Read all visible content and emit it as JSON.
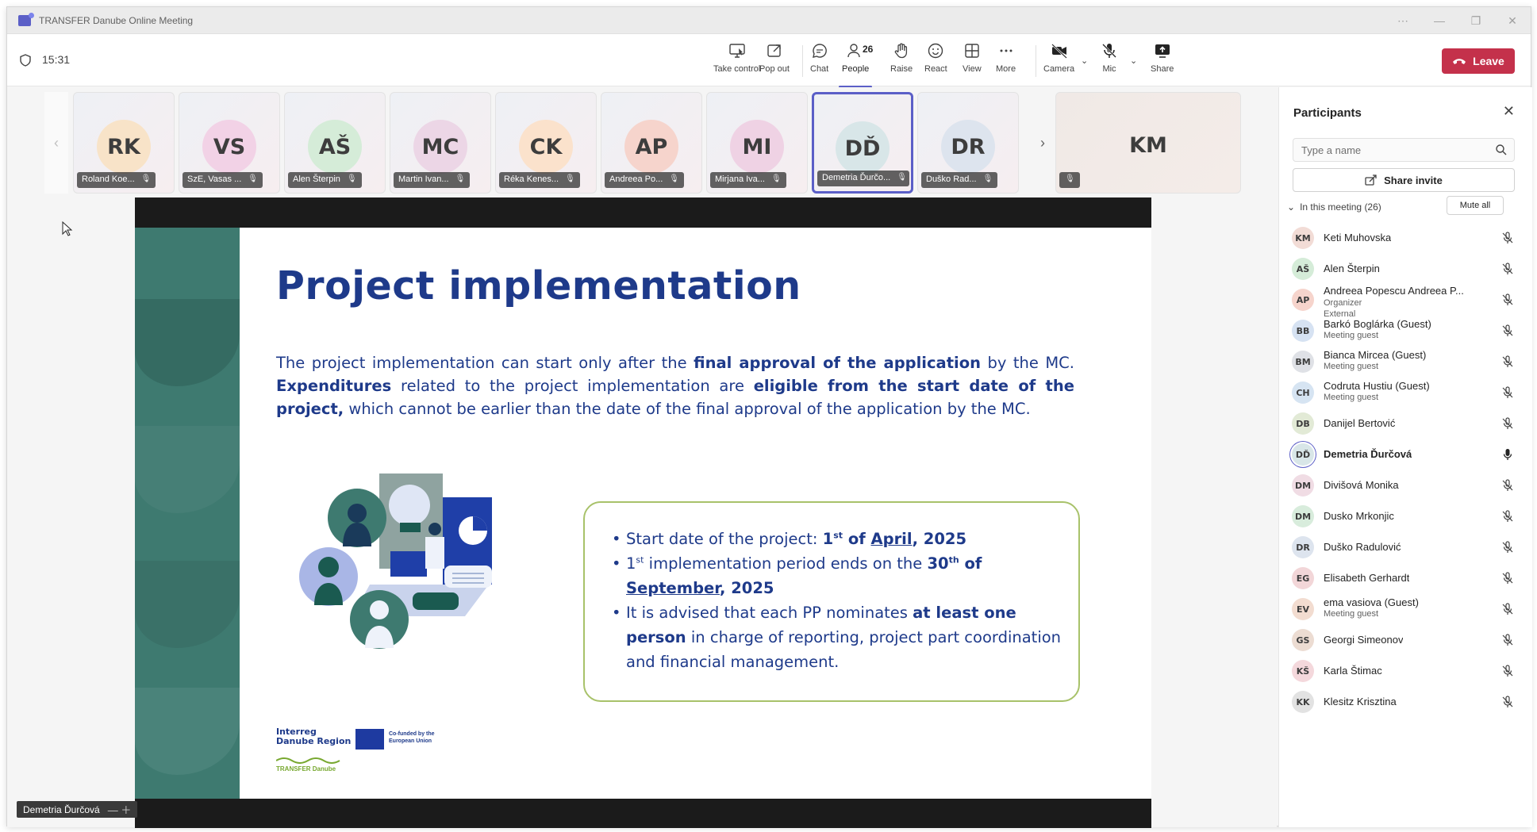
{
  "window": {
    "title": "TRANSFER Danube Online Meeting",
    "controls": [
      "⋯",
      "—",
      "❐",
      "✕"
    ]
  },
  "toolbar": {
    "time": "15:31",
    "take_control": "Take control",
    "pop_out": "Pop out",
    "chat": "Chat",
    "people": "People",
    "people_count": "26",
    "raise": "Raise",
    "react": "React",
    "view": "View",
    "more": "More",
    "camera": "Camera",
    "mic": "Mic",
    "share": "Share",
    "leave": "Leave",
    "leave_color": "#c4314b",
    "accent": "#5b5fc7"
  },
  "tiles": [
    {
      "initials": "RK",
      "name": "Roland Koe...",
      "color": "#f8e3c8"
    },
    {
      "initials": "VS",
      "name": "SzE, Vasas ...",
      "color": "#f2d2e6"
    },
    {
      "initials": "AŠ",
      "name": "Alen Šterpin",
      "color": "#d5ecd8"
    },
    {
      "initials": "MC",
      "name": "Martin Ivan...",
      "color": "#ecd6e6"
    },
    {
      "initials": "CK",
      "name": "Réka Kenes...",
      "color": "#fbe2cc"
    },
    {
      "initials": "AP",
      "name": "Andreea Po...",
      "color": "#f6d4cc"
    },
    {
      "initials": "MI",
      "name": "Mirjana Iva...",
      "color": "#efd2e4"
    },
    {
      "initials": "DĎ",
      "name": "Demetria Ďurčo...",
      "color": "#d8e6e8"
    },
    {
      "initials": "DR",
      "name": "Duško Rad...",
      "color": "#dde4ee"
    }
  ],
  "big_tile": {
    "initials": "KM"
  },
  "slide": {
    "title": "Project implementation",
    "p1a": "The project implementation can start only after the ",
    "p1b": "final approval of the application",
    "p1c": " by the MC. ",
    "p2a": "Expenditures",
    "p2b": " related to the project implementation are ",
    "p2c": "eligible from the start date of the project,",
    "p2d": " which cannot be earlier than the date of the final approval of the application by the MC.",
    "b1a": "Start date of the project: ",
    "b1b": "1",
    "b1sup": "st",
    "b1c": " of ",
    "b1d": "April",
    "b1e": ", 2025",
    "b2a": "1",
    "b2sup": "st",
    "b2b": " implementation period ends on the ",
    "b2c": "30",
    "b2sup2": "th",
    "b2d": " of ",
    "b2e": "September",
    "b2f": ", 2025",
    "b3a": "It is advised that each PP nominates ",
    "b3b": "at least one person",
    "b3c": " in charge of reporting, project part coordination and financial management.",
    "logo1": "Interreg",
    "logo2": "Danube Region",
    "logo_eu": "Co-funded by the European Union",
    "logo_tr": "TRANSFER Danube"
  },
  "speaker_label": "Demetria Ďurčová",
  "participants_panel": {
    "title": "Participants",
    "search_placeholder": "Type a name",
    "share_invite": "Share invite",
    "in_meeting": "In this meeting (26)",
    "mute_all": "Mute all",
    "list": [
      {
        "initials": "KM",
        "name": "Keti Muhovska",
        "role": "",
        "color": "#f2dcd6"
      },
      {
        "initials": "AŠ",
        "name": "Alen Šterpin",
        "role": "",
        "color": "#d5ecd8"
      },
      {
        "initials": "AP",
        "name": "Andreea Popescu Andreea P...",
        "role": "Organizer",
        "role2": "External",
        "color": "#f6d4cc"
      },
      {
        "initials": "BB",
        "name": "Barkó Boglárka (Guest)",
        "role": "Meeting guest",
        "color": "#d6e2f2"
      },
      {
        "initials": "BM",
        "name": "Bianca Mircea (Guest)",
        "role": "Meeting guest",
        "color": "#dfe1e6"
      },
      {
        "initials": "CH",
        "name": "Codruta Hustiu (Guest)",
        "role": "Meeting guest",
        "color": "#d6e4f2"
      },
      {
        "initials": "DB",
        "name": "Danijel Bertović",
        "role": "",
        "color": "#e2ead6"
      },
      {
        "initials": "DĎ",
        "name": "Demetria Ďurčová",
        "role": "",
        "color": "#d8e6e8",
        "active": true
      },
      {
        "initials": "DM",
        "name": "Divišová Monika",
        "role": "",
        "color": "#f0dce4"
      },
      {
        "initials": "DM",
        "name": "Dusko Mrkonjic",
        "role": "",
        "color": "#d8ecdc"
      },
      {
        "initials": "DR",
        "name": "Duško Radulović",
        "role": "",
        "color": "#dde4ee"
      },
      {
        "initials": "EG",
        "name": "Elisabeth Gerhardt",
        "role": "",
        "color": "#f2d6d8"
      },
      {
        "initials": "EV",
        "name": "ema vasiova (Guest)",
        "role": "Meeting guest",
        "color": "#f2dcd0"
      },
      {
        "initials": "GS",
        "name": "Georgi Simeonov",
        "role": "",
        "color": "#ecdcd2"
      },
      {
        "initials": "KŠ",
        "name": "Karla Štimac",
        "role": "",
        "color": "#f4d8dc"
      },
      {
        "initials": "KK",
        "name": "Klesitz Krisztina",
        "role": "",
        "color": "#e2e2e2"
      }
    ]
  }
}
